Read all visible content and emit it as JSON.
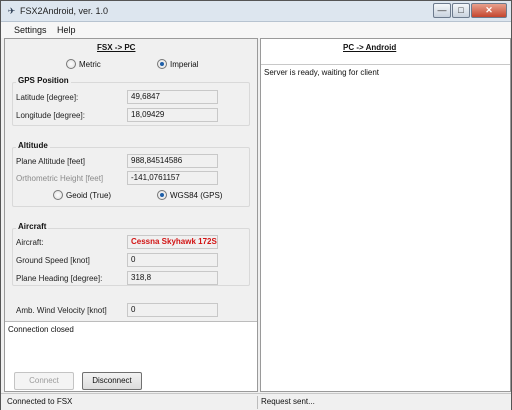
{
  "window": {
    "title": "FSX2Android, ver. 1.0",
    "icon": "plane-icon",
    "minimize_glyph": "—",
    "maximize_glyph": "□",
    "close_glyph": "✕"
  },
  "menu": {
    "items": [
      "Settings",
      "Help"
    ]
  },
  "left": {
    "header": "FSX -> PC",
    "units": {
      "options": [
        "Metric",
        "Imperial"
      ],
      "selected": "Imperial"
    },
    "gps": {
      "title": "GPS Position",
      "latitude_label": "Latitude [degree]:",
      "latitude_value": "49,6847",
      "longitude_label": "Longitude [degree]:",
      "longitude_value": "18,09429"
    },
    "altitude": {
      "title": "Altitude",
      "plane_label": "Plane Altitude [feet]",
      "plane_value": "988,84514586",
      "ortho_label": "Orthometric Height [feet]",
      "ortho_value": "-141,0761157",
      "model_options": [
        "Geoid (True)",
        "WGS84 (GPS)"
      ],
      "model_selected": "WGS84 (GPS)"
    },
    "aircraft": {
      "title": "Aircraft",
      "aircraft_label": "Aircraft:",
      "aircraft_value": "Cessna Skyhawk 172SP",
      "speed_label": "Ground Speed [knot]",
      "speed_value": "0",
      "heading_label": "Plane Heading [degree]:",
      "heading_value": "318,8"
    },
    "wind": {
      "label": "Amb. Wind Velocity [knot]",
      "value": "0"
    },
    "log": "Connection closed",
    "buttons": {
      "connect": "Connect",
      "disconnect": "Disconnect"
    }
  },
  "right": {
    "header": "PC -> Android",
    "log": "Server is ready, waiting for client"
  },
  "status": {
    "left": "Connected to FSX",
    "right": "Request sent..."
  }
}
